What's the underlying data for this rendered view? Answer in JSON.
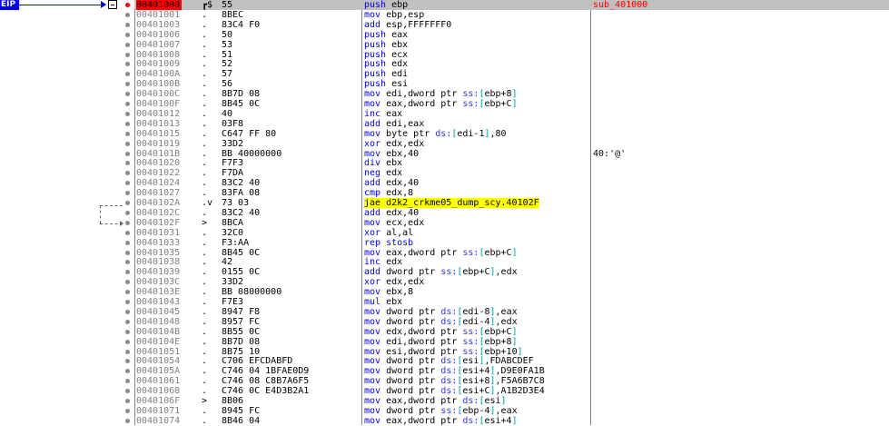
{
  "eip_label": "EIP",
  "colors": {
    "eip": "#0000ff",
    "current_address_bg": "#ff0000",
    "jump_highlight": "#ffff00",
    "label_text": "#ff0000"
  },
  "rows": [
    {
      "address": "00401000",
      "marker": "┏$",
      "bytes": "55",
      "asm": "push ebp",
      "comment": "sub_401000"
    },
    {
      "address": "00401001",
      "marker": ".",
      "bytes": "8BEC",
      "asm": "mov ebp,esp",
      "comment": ""
    },
    {
      "address": "00401003",
      "marker": ".",
      "bytes": "83C4 F0",
      "asm": "add esp,FFFFFFF0",
      "comment": ""
    },
    {
      "address": "00401006",
      "marker": ".",
      "bytes": "50",
      "asm": "push eax",
      "comment": ""
    },
    {
      "address": "00401007",
      "marker": ".",
      "bytes": "53",
      "asm": "push ebx",
      "comment": ""
    },
    {
      "address": "00401008",
      "marker": ".",
      "bytes": "51",
      "asm": "push ecx",
      "comment": ""
    },
    {
      "address": "00401009",
      "marker": ".",
      "bytes": "52",
      "asm": "push edx",
      "comment": ""
    },
    {
      "address": "0040100A",
      "marker": ".",
      "bytes": "57",
      "asm": "push edi",
      "comment": ""
    },
    {
      "address": "0040100B",
      "marker": ".",
      "bytes": "56",
      "asm": "push esi",
      "comment": ""
    },
    {
      "address": "0040100C",
      "marker": ".",
      "bytes": "8B7D 08",
      "asm": "mov edi,dword ptr ss:[ebp+8]",
      "comment": ""
    },
    {
      "address": "0040100F",
      "marker": ".",
      "bytes": "8B45 0C",
      "asm": "mov eax,dword ptr ss:[ebp+C]",
      "comment": ""
    },
    {
      "address": "00401012",
      "marker": ".",
      "bytes": "40",
      "asm": "inc eax",
      "comment": ""
    },
    {
      "address": "00401013",
      "marker": ".",
      "bytes": "03F8",
      "asm": "add edi,eax",
      "comment": ""
    },
    {
      "address": "00401015",
      "marker": ".",
      "bytes": "C647 FF 80",
      "asm": "mov byte ptr ds:[edi-1],80",
      "comment": ""
    },
    {
      "address": "00401019",
      "marker": ".",
      "bytes": "33D2",
      "asm": "xor edx,edx",
      "comment": ""
    },
    {
      "address": "0040101B",
      "marker": ".",
      "bytes": "BB 40000000",
      "asm": "mov ebx,40",
      "comment": "40:'@'"
    },
    {
      "address": "00401020",
      "marker": ".",
      "bytes": "F7F3",
      "asm": "div ebx",
      "comment": ""
    },
    {
      "address": "00401022",
      "marker": ".",
      "bytes": "F7DA",
      "asm": "neg edx",
      "comment": ""
    },
    {
      "address": "00401024",
      "marker": ".",
      "bytes": "83C2 40",
      "asm": "add edx,40",
      "comment": ""
    },
    {
      "address": "00401027",
      "marker": ".",
      "bytes": "83FA 08",
      "asm": "cmp edx,8",
      "comment": ""
    },
    {
      "address": "0040102A",
      "marker": ".v",
      "bytes": "73 03",
      "asm": "jae d2k2_crkme05_dump_scy.40102F",
      "comment": ""
    },
    {
      "address": "0040102C",
      "marker": ".",
      "bytes": "83C2 40",
      "asm": "add edx,40",
      "comment": ""
    },
    {
      "address": "0040102F",
      "marker": ">",
      "bytes": "8BCA",
      "asm": "mov ecx,edx",
      "comment": ""
    },
    {
      "address": "00401031",
      "marker": ".",
      "bytes": "32C0",
      "asm": "xor al,al",
      "comment": ""
    },
    {
      "address": "00401033",
      "marker": ".",
      "bytes": "F3:AA",
      "asm": "rep stosb",
      "comment": ""
    },
    {
      "address": "00401035",
      "marker": ".",
      "bytes": "8B45 0C",
      "asm": "mov eax,dword ptr ss:[ebp+C]",
      "comment": ""
    },
    {
      "address": "00401038",
      "marker": ".",
      "bytes": "42",
      "asm": "inc edx",
      "comment": ""
    },
    {
      "address": "00401039",
      "marker": ".",
      "bytes": "0155 0C",
      "asm": "add dword ptr ss:[ebp+C],edx",
      "comment": ""
    },
    {
      "address": "0040103C",
      "marker": ".",
      "bytes": "33D2",
      "asm": "xor edx,edx",
      "comment": ""
    },
    {
      "address": "0040103E",
      "marker": ".",
      "bytes": "BB 08000000",
      "asm": "mov ebx,8",
      "comment": ""
    },
    {
      "address": "00401043",
      "marker": ".",
      "bytes": "F7E3",
      "asm": "mul ebx",
      "comment": ""
    },
    {
      "address": "00401045",
      "marker": ".",
      "bytes": "8947 F8",
      "asm": "mov dword ptr ds:[edi-8],eax",
      "comment": ""
    },
    {
      "address": "00401048",
      "marker": ".",
      "bytes": "8957 FC",
      "asm": "mov dword ptr ds:[edi-4],edx",
      "comment": ""
    },
    {
      "address": "0040104B",
      "marker": ".",
      "bytes": "8B55 0C",
      "asm": "mov edx,dword ptr ss:[ebp+C]",
      "comment": ""
    },
    {
      "address": "0040104E",
      "marker": ".",
      "bytes": "8B7D 08",
      "asm": "mov edi,dword ptr ss:[ebp+8]",
      "comment": ""
    },
    {
      "address": "00401051",
      "marker": ".",
      "bytes": "8B75 10",
      "asm": "mov esi,dword ptr ss:[ebp+10]",
      "comment": ""
    },
    {
      "address": "00401054",
      "marker": ".",
      "bytes": "C706 EFCDABFD",
      "asm": "mov dword ptr ds:[esi],FDABCDEF",
      "comment": ""
    },
    {
      "address": "0040105A",
      "marker": ".",
      "bytes": "C746 04 1BFAE0D9",
      "asm": "mov dword ptr ds:[esi+4],D9E0FA1B",
      "comment": ""
    },
    {
      "address": "00401061",
      "marker": ".",
      "bytes": "C746 08 C8B7A6F5",
      "asm": "mov dword ptr ds:[esi+8],F5A6B7C8",
      "comment": ""
    },
    {
      "address": "00401068",
      "marker": ".",
      "bytes": "C746 0C E4D3B2A1",
      "asm": "mov dword ptr ds:[esi+C],A1B2D3E4",
      "comment": ""
    },
    {
      "address": "0040106F",
      "marker": ">",
      "bytes": "8B06",
      "asm": "mov eax,dword ptr ds:[esi]",
      "comment": ""
    },
    {
      "address": "00401071",
      "marker": ".",
      "bytes": "8945 FC",
      "asm": "mov dword ptr ss:[ebp-4],eax",
      "comment": ""
    },
    {
      "address": "00401074",
      "marker": ".",
      "bytes": "8B46 04",
      "asm": "mov eax,dword ptr ds:[esi+4]",
      "comment": ""
    }
  ]
}
